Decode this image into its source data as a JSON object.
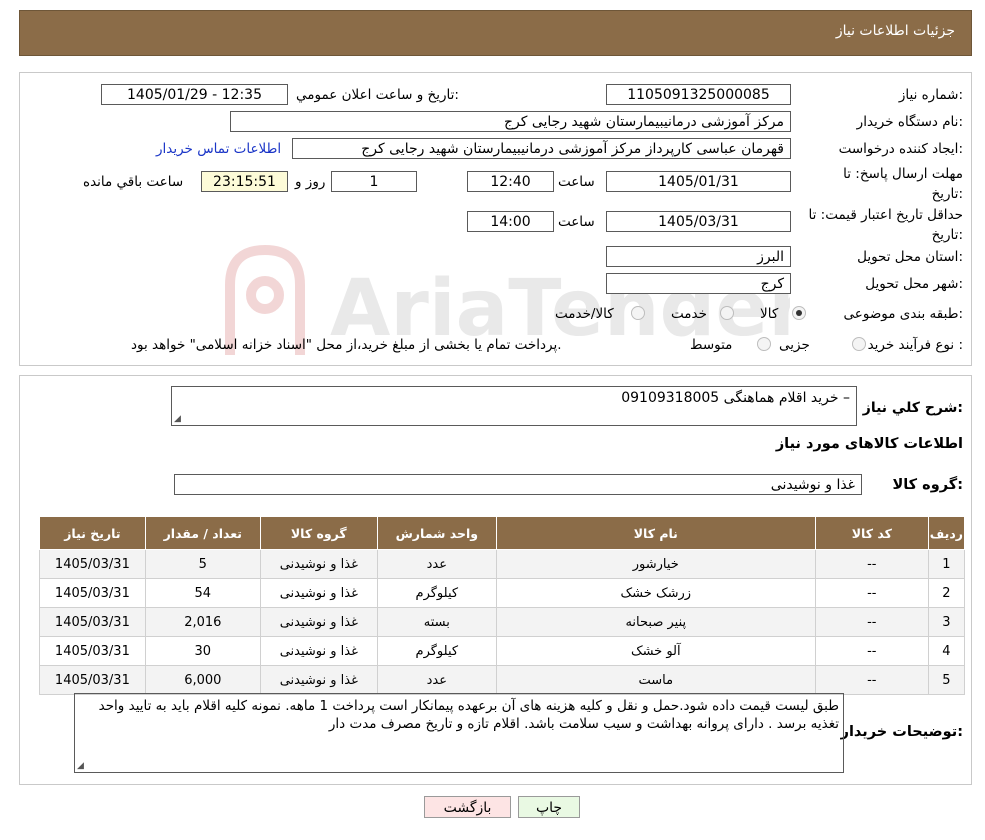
{
  "header": {
    "title": "جزئیات اطلاعات نیاز"
  },
  "fields": {
    "need_number_label": "شماره نیاز:",
    "need_number": "1105091325000085",
    "announce_label": "تاریخ و ساعت اعلان عمومي:",
    "announce_value": "1405/01/29 - 12:35",
    "buyer_org_label": "نام دستگاه خریدار:",
    "buyer_org": "مرکز آموزشی درمانیبیمارستان شهید رجایی کرج",
    "creator_label": "ایجاد کننده درخواست:",
    "creator": "قهرمان عباسی کارپرداز مرکز آموزشی درمانیبیمارستان شهید رجایی کرج",
    "contact_link": "اطلاعات تماس خریدار",
    "deadline_label": "مهلت ارسال پاسخ: تا تاریخ:",
    "deadline_date": "1405/01/31",
    "time_label": "ساعت",
    "deadline_time": "12:40",
    "days_value": "1",
    "days_label": "روز و",
    "remaining_time": "23:15:51",
    "remaining_label": "ساعت باقي مانده",
    "validity_label": "حداقل تاریخ اعتبار قیمت: تا تاریخ:",
    "validity_date": "1405/03/31",
    "validity_time": "14:00",
    "province_label": "استان محل تحویل:",
    "province": "البرز",
    "city_label": "شهر محل تحویل:",
    "city": "کرج",
    "category_label": "طبقه بندی موضوعی:",
    "category_options": [
      "کالا",
      "خدمت",
      "کالا/خدمت"
    ],
    "category_selected": "کالا",
    "process_label": "نوع فرآیند خرید :",
    "process_options": [
      "جزیی",
      "متوسط"
    ],
    "process_note": "پرداخت تمام یا بخشی از مبلغ خرید،از محل \"اسناد خزانه اسلامی\" خواهد بود."
  },
  "watermark": {
    "text": "AriaTender.neT"
  },
  "description": {
    "label": "شرح کلي نیاز:",
    "value": "خرید اقلام  هماهنگی  09109318005 –"
  },
  "items_section": {
    "title": "اطلاعات کالاهای مورد نیاز",
    "group_label": "گروه کالا:",
    "group_value": "غذا و نوشیدنی"
  },
  "table": {
    "headers": [
      "ردیف",
      "کد کالا",
      "نام کالا",
      "واحد شمارش",
      "گروه کالا",
      "تعداد / مقدار",
      "تاریخ نیاز"
    ],
    "rows": [
      [
        "1",
        "--",
        "خیارشور",
        "عدد",
        "غذا و نوشیدنی",
        "5",
        "1405/03/31"
      ],
      [
        "2",
        "--",
        "زرشک خشک",
        "کیلوگرم",
        "غذا و نوشیدنی",
        "54",
        "1405/03/31"
      ],
      [
        "3",
        "--",
        "پنیر صبحانه",
        "بسته",
        "غذا و نوشیدنی",
        "2,016",
        "1405/03/31"
      ],
      [
        "4",
        "--",
        "آلو خشک",
        "کیلوگرم",
        "غذا و نوشیدنی",
        "30",
        "1405/03/31"
      ],
      [
        "5",
        "--",
        "ماست",
        "عدد",
        "غذا و نوشیدنی",
        "6,000",
        "1405/03/31"
      ]
    ]
  },
  "buyer_notes": {
    "label": "توضیحات خریدار:",
    "value": "طبق لیست قیمت داده شود.حمل و نقل و  کلیه هزینه های آن برعهده پیمانکار است پرداخت 1 ماهه. نمونه کلیه اقلام باید به تایید واحد تغذیه برسد . دارای پروانه بهداشت و سیب سلامت باشد. اقلام تازه و  تاریخ مصرف مدت دار"
  },
  "buttons": {
    "print": "چاپ",
    "back": "بازگشت"
  },
  "colors": {
    "header": "#8b6c48",
    "link": "#1a35c7",
    "print_bg": "#e9f9e3",
    "back_bg": "#fde4e4",
    "remaining_bg": "#fdfbd8"
  }
}
